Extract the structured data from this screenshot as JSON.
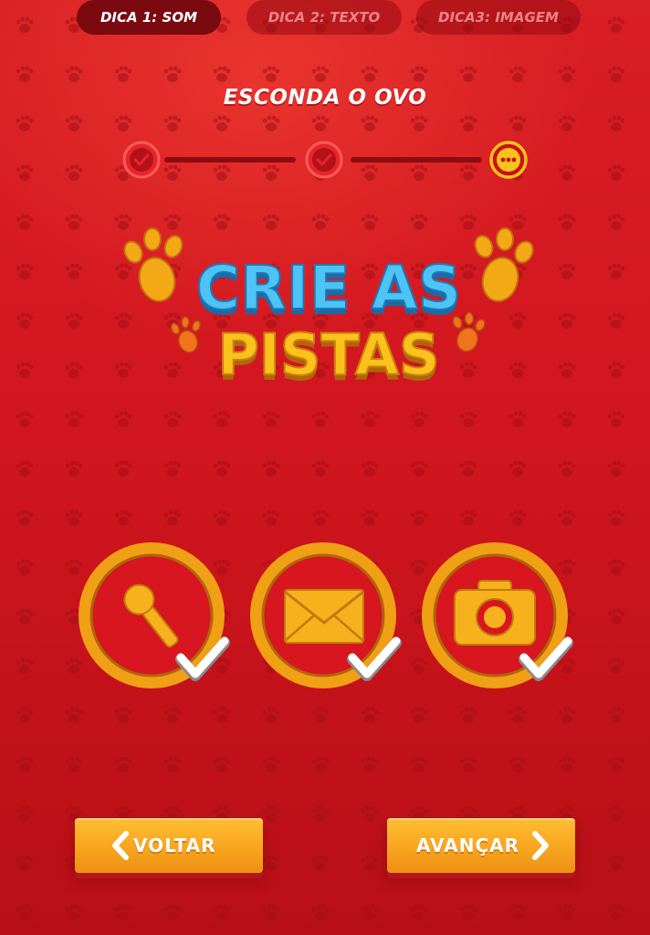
{
  "header": {
    "title": "ESCONDA O OVO"
  },
  "progress": {
    "steps": [
      {
        "state": "done",
        "icon": "check-icon"
      },
      {
        "state": "done",
        "icon": "check-icon"
      },
      {
        "state": "current",
        "icon": "ellipsis-icon"
      }
    ]
  },
  "hero": {
    "line1": "CRIE AS",
    "line2": "PISTAS"
  },
  "tabs": [
    {
      "label": "DICA 1: SOM",
      "active": true
    },
    {
      "label": "DICA 2: TEXTO",
      "active": false
    },
    {
      "label": "DICA3: IMAGEM",
      "active": false
    }
  ],
  "clues": [
    {
      "icon": "microphone-icon",
      "completed": true
    },
    {
      "icon": "envelope-icon",
      "completed": true
    },
    {
      "icon": "camera-icon",
      "completed": true
    }
  ],
  "nav": {
    "back_label": "VOLTAR",
    "next_label": "AVANÇAR"
  },
  "colors": {
    "background": "#d2161f",
    "accent": "#f8a51f",
    "hero_blue": "#3cb6ec",
    "hero_yellow": "#fbc21c",
    "step_done": "#e0202a",
    "step_current": "#fbc21c"
  }
}
